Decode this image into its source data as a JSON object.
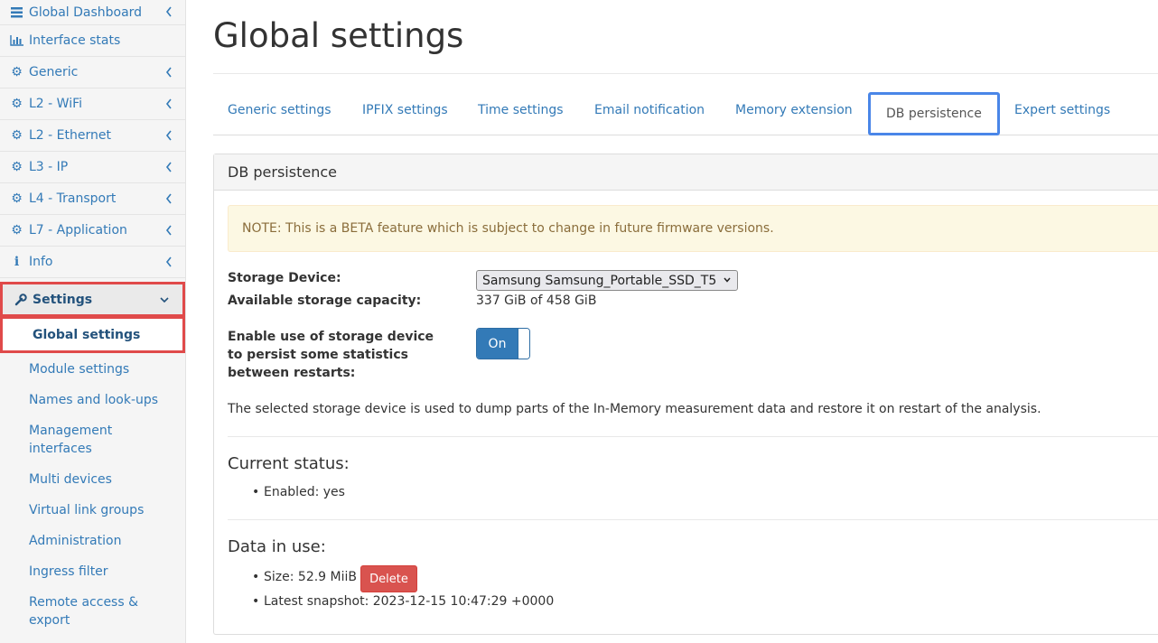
{
  "sidebar": {
    "items": [
      {
        "label": "Global Dashboard",
        "icon": "dashboard-icon"
      },
      {
        "label": "Interface stats",
        "icon": "bar-chart-icon"
      },
      {
        "label": "Generic",
        "icon": "gear-icon"
      },
      {
        "label": "L2 - WiFi",
        "icon": "gear-icon"
      },
      {
        "label": "L2 - Ethernet",
        "icon": "gear-icon"
      },
      {
        "label": "L3 - IP",
        "icon": "gear-icon"
      },
      {
        "label": "L4 - Transport",
        "icon": "gear-icon"
      },
      {
        "label": "L7 - Application",
        "icon": "gear-icon"
      },
      {
        "label": "Info",
        "icon": "info-icon"
      }
    ],
    "settings": {
      "label": "Settings",
      "icon": "wrench-icon"
    },
    "sub_items": [
      "Global settings",
      "Module settings",
      "Names and look-ups",
      "Management interfaces",
      "Multi devices",
      "Virtual link groups",
      "Administration",
      "Ingress filter",
      "Remote access & export"
    ]
  },
  "page": {
    "title": "Global settings",
    "tabs": [
      "Generic settings",
      "IPFIX settings",
      "Time settings",
      "Email notification",
      "Memory extension",
      "DB persistence",
      "Expert settings"
    ],
    "active_tab": "DB persistence"
  },
  "panel": {
    "title": "DB persistence",
    "note": "NOTE: This is a BETA feature which is subject to change in future firmware versions.",
    "storage_device_label": "Storage Device:",
    "storage_device_value": "Samsung Samsung_Portable_SSD_T5",
    "capacity_label": "Available storage capacity:",
    "capacity_value": "337 GiB of 458 GiB",
    "enable_label_1": "Enable use of storage device",
    "enable_label_2": "to persist some statistics",
    "enable_label_3": "between restarts:",
    "toggle_label": "On",
    "description": "The selected storage device is used to dump parts of the In-Memory measurement data and restore it on restart of the analysis.",
    "status_heading": "Current status:",
    "status_enabled": "Enabled: yes",
    "data_heading": "Data in use:",
    "size": "Size: 52.9 MiiB",
    "delete_label": "Delete",
    "snapshot": "Latest snapshot: 2023-12-15 10:47:29 +0000"
  },
  "colors": {
    "link": "#337ab7",
    "highlight": "#e04a4a",
    "active_tab_border": "#4a86e8",
    "danger": "#d9534f",
    "toggle_on": "#337ab7"
  }
}
